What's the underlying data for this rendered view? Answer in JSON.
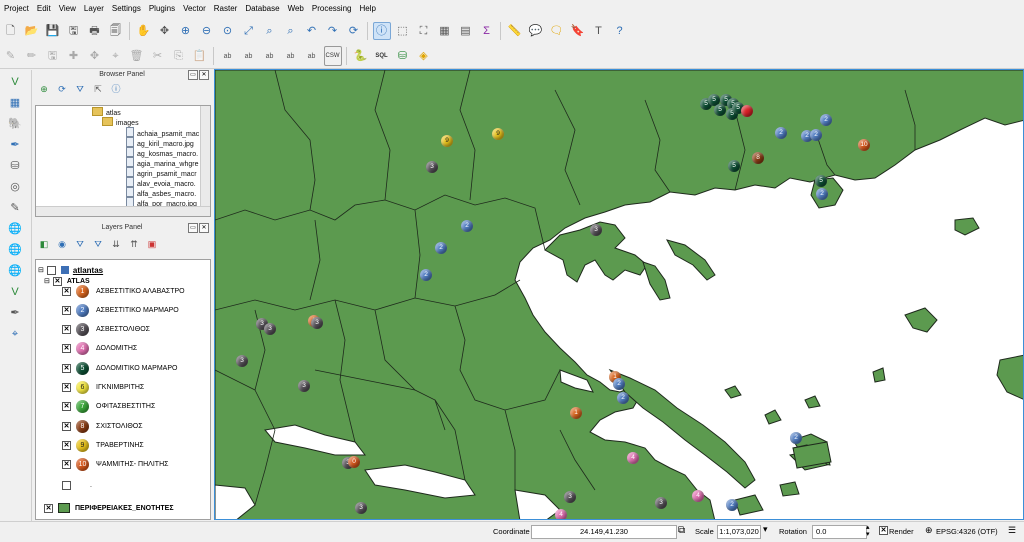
{
  "colors": {
    "land": "#5c9a4f",
    "sea": "#ffffff",
    "border": "#1e2a1c",
    "accent": "#3b8fd8"
  },
  "menubar": {
    "items": [
      "Project",
      "Edit",
      "View",
      "Layer",
      "Settings",
      "Plugins",
      "Vector",
      "Raster",
      "Database",
      "Web",
      "Processing",
      "Help"
    ]
  },
  "toolbar1": {
    "icons": [
      "new-project-icon",
      "open-project-icon",
      "save-project-icon",
      "save-as-icon",
      "print-composer-icon",
      "composer-manager-icon",
      "pan-icon",
      "pan-to-selection-icon",
      "zoom-in-icon",
      "zoom-out-icon",
      "zoom-native-icon",
      "zoom-full-icon",
      "zoom-to-selection-icon",
      "zoom-to-layer-icon",
      "zoom-last-icon",
      "zoom-next-icon",
      "refresh-icon",
      "identify-icon",
      "select-icon",
      "select-location-icon",
      "deselect-icon",
      "attribute-table-icon",
      "statistics-icon",
      "measure-icon",
      "annotation-icon",
      "map-tips-icon",
      "bookmark-icon",
      "text-annotation-icon",
      "help-icon"
    ]
  },
  "toolbar2": {
    "icons": [
      "edit-pencil-icon",
      "toggle-editing-icon",
      "save-edits-icon",
      "add-feature-icon",
      "move-feature-icon",
      "node-tool-icon",
      "delete-selected-icon",
      "cut-icon",
      "copy-icon",
      "paste-icon",
      "label-icon",
      "label-pin-icon",
      "label-move-icon",
      "label-rotate-icon",
      "label-change-icon",
      "csw-label",
      "python-icon",
      "sql-label",
      "db-manager-icon",
      "layers-stack-icon"
    ],
    "csw_label": "CSW",
    "sql_label": "SQL"
  },
  "left_toolbar": {
    "icons": [
      "add-vector-icon",
      "add-raster-icon",
      "add-postgis-icon",
      "add-spatialite-icon",
      "add-mssql-icon",
      "add-oracle-icon",
      "add-delimited-text-icon",
      "add-wms-icon",
      "add-wcs-icon",
      "add-wfs-icon",
      "new-shapefile-icon",
      "new-spatialite-icon",
      "gps-icon"
    ]
  },
  "browser_panel": {
    "title": "Browser Panel",
    "tree": [
      {
        "label": "atlas",
        "type": "folder"
      },
      {
        "label": "images",
        "type": "folder"
      },
      {
        "label": "achaia_psamit_mac",
        "type": "file"
      },
      {
        "label": "ag_kiril_macro.jpg",
        "type": "file"
      },
      {
        "label": "ag_kosmas_macro.",
        "type": "file"
      },
      {
        "label": "agia_marina_whgre",
        "type": "file"
      },
      {
        "label": "agrin_psamit_macr",
        "type": "file"
      },
      {
        "label": "alav_evoia_macro.",
        "type": "file"
      },
      {
        "label": "alfa_asbes_macro.",
        "type": "file"
      },
      {
        "label": "alfa_por_macro.jpg",
        "type": "file"
      }
    ]
  },
  "layers_panel": {
    "title": "Layers Panel",
    "group": "atlantas",
    "sublayer": "ATLAS",
    "items": [
      {
        "num": "1",
        "label": "ΑΣΒΕΣΤΙΤΙΚΟ ΑΛΑΒΑΣΤΡΟ",
        "color": "#d9651e"
      },
      {
        "num": "2",
        "label": "ΑΣΒΕΣΤΙΤΙΚΟ ΜΑΡΜΑΡΟ",
        "color": "#4f7cc2"
      },
      {
        "num": "3",
        "label": "ΑΣΒΕΣΤΟΛΙΘΟΣ",
        "color": "#555057"
      },
      {
        "num": "4",
        "label": "ΔΟΛΟΜΙΤΗΣ",
        "color": "#e06fb0"
      },
      {
        "num": "5",
        "label": "ΔΟΛΟΜΙΤΙΚΟ ΜΑΡΜΑΡΟ",
        "color": "#0d4f34"
      },
      {
        "num": "6",
        "label": "ΙΓΚΝΙΜΒΡΙΤΗΣ",
        "color": "#f2e640"
      },
      {
        "num": "7",
        "label": "ΟΦΙΤΑΣΒΕΣΤΙΤΗΣ",
        "color": "#3aa63a"
      },
      {
        "num": "8",
        "label": "ΣΧΙΣΤΟΛΙΘΟΣ",
        "color": "#8a3b12"
      },
      {
        "num": "9",
        "label": "ΤΡΑΒΕΡΤΙΝΗΣ",
        "color": "#e8c21a"
      },
      {
        "num": "10",
        "label": "ΨΑΜΜΙΤΗΣ- ΠΗΛΙΤΗΣ",
        "color": "#d4561a"
      }
    ],
    "empty_item": ".",
    "polygon_layer": "ΠΕΡΙΦΕΡΕΙΑΚΕΣ_ΕΝΟΤΗΤΕΣ"
  },
  "map": {
    "markers": [
      {
        "n": "9",
        "c": "#e8c21a"
      },
      {
        "n": "9",
        "c": "#e8c21a"
      },
      {
        "n": "3",
        "c": "#555057"
      },
      {
        "n": "5",
        "c": "#0d4f34"
      },
      {
        "n": "5",
        "c": "#0d4f34"
      },
      {
        "n": "5",
        "c": "#0d4f34"
      },
      {
        "n": "5",
        "c": "#0d4f34"
      },
      {
        "n": "5",
        "c": "#0d4f34"
      },
      {
        "n": "5",
        "c": "#0d4f34"
      },
      {
        "n": "5",
        "c": "#0d4f34"
      },
      {
        "n": "",
        "c": "#d81f26"
      },
      {
        "n": "2",
        "c": "#4f7cc2"
      },
      {
        "n": "2",
        "c": "#4f7cc2"
      },
      {
        "n": "2",
        "c": "#4f7cc2"
      },
      {
        "n": "2",
        "c": "#4f7cc2"
      },
      {
        "n": "10",
        "c": "#d4561a"
      },
      {
        "n": "8",
        "c": "#8a3b12"
      },
      {
        "n": "5",
        "c": "#0d4f34"
      },
      {
        "n": "5",
        "c": "#0d4f34"
      },
      {
        "n": "2",
        "c": "#4f7cc2"
      },
      {
        "n": "2",
        "c": "#4f7cc2"
      },
      {
        "n": "2",
        "c": "#4f7cc2"
      },
      {
        "n": "2",
        "c": "#4f7cc2"
      },
      {
        "n": "3",
        "c": "#555057"
      },
      {
        "n": "3",
        "c": "#555057"
      },
      {
        "n": "3",
        "c": "#555057"
      },
      {
        "n": "1",
        "c": "#d9651e"
      },
      {
        "n": "3",
        "c": "#555057"
      },
      {
        "n": "3",
        "c": "#555057"
      },
      {
        "n": "3",
        "c": "#555057"
      },
      {
        "n": "1",
        "c": "#d9651e"
      },
      {
        "n": "2",
        "c": "#4f7cc2"
      },
      {
        "n": "2",
        "c": "#4f7cc2"
      },
      {
        "n": "2",
        "c": "#4f7cc2"
      },
      {
        "n": "4",
        "c": "#e06fb0"
      },
      {
        "n": "1",
        "c": "#d9651e"
      },
      {
        "n": "3",
        "c": "#555057"
      },
      {
        "n": "0",
        "c": "#d4561a"
      },
      {
        "n": "3",
        "c": "#555057"
      },
      {
        "n": "3",
        "c": "#555057"
      },
      {
        "n": "4",
        "c": "#e06fb0"
      },
      {
        "n": "4",
        "c": "#e06fb0"
      },
      {
        "n": "3",
        "c": "#555057"
      },
      {
        "n": "2",
        "c": "#4f7cc2"
      }
    ]
  },
  "statusbar": {
    "coordinate_label": "Coordinate",
    "coordinate_value": "24.149,41.230",
    "scale_label": "Scale",
    "scale_value": "1:1,073,020",
    "rotation_label": "Rotation",
    "rotation_value": "0.0",
    "render_label": "Render",
    "crs_label": "EPSG:4326 (OTF)"
  }
}
